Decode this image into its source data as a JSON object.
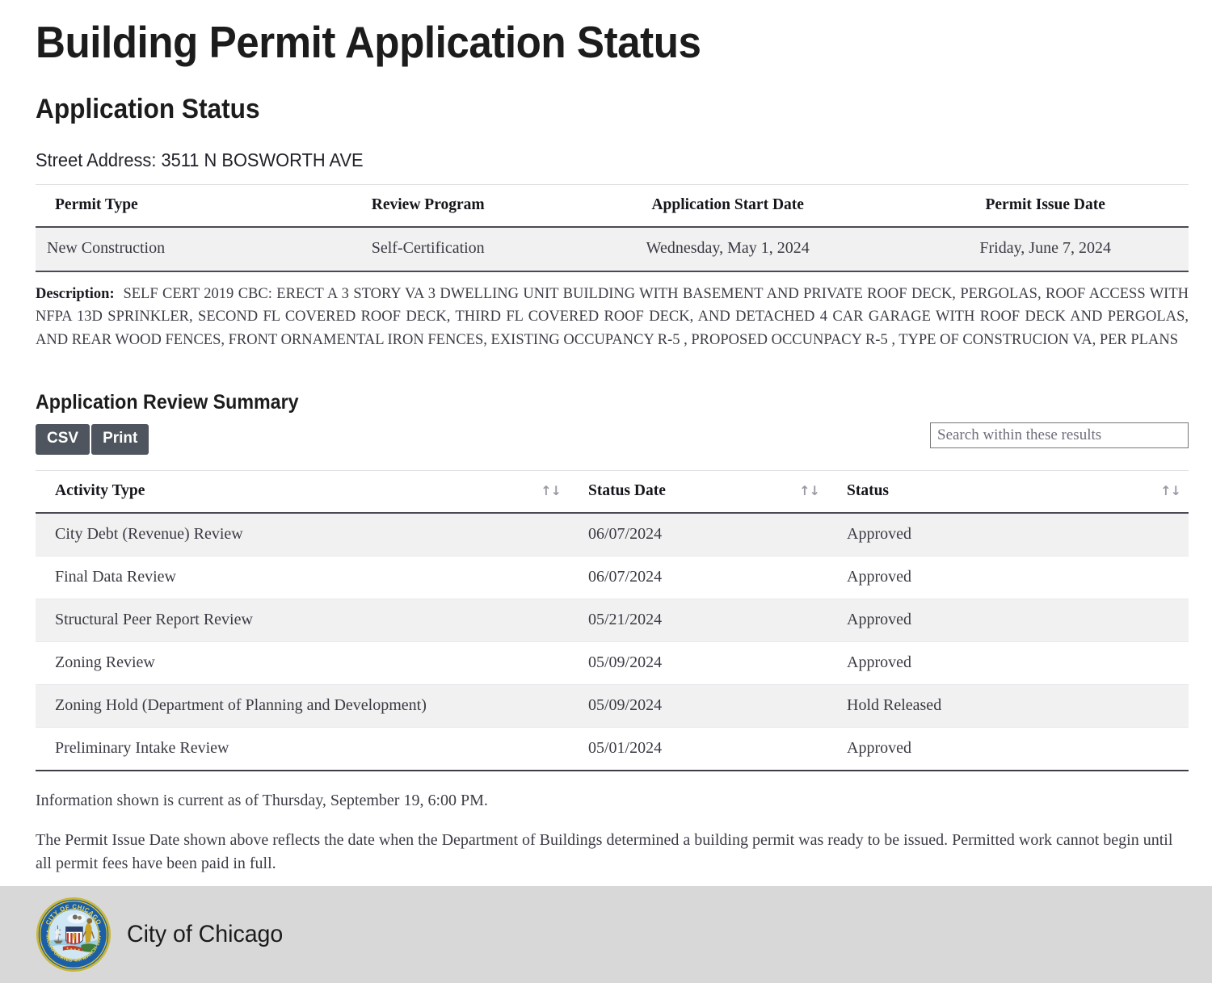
{
  "page": {
    "title": "Building Permit Application Status",
    "section_heading": "Application Status",
    "street_address": "Street Address: 3511 N BOSWORTH AVE"
  },
  "permit_summary": {
    "columns": [
      "Permit Type",
      "Review Program",
      "Application Start Date",
      "Permit Issue Date"
    ],
    "row": {
      "permit_type": "New Construction",
      "review_program": "Self-Certification",
      "application_start_date": "Wednesday, May 1, 2024",
      "permit_issue_date": "Friday, June 7, 2024"
    }
  },
  "description": {
    "label": "Description:",
    "text": "SELF CERT 2019 CBC: ERECT A 3 STORY VA 3 DWELLING UNIT BUILDING WITH BASEMENT AND PRIVATE ROOF DECK, PERGOLAS, ROOF ACCESS WITH NFPA 13D SPRINKLER, SECOND FL COVERED ROOF DECK, THIRD FL COVERED ROOF DECK, AND DETACHED 4 CAR GARAGE WITH ROOF DECK AND PERGOLAS, AND REAR WOOD FENCES, FRONT ORNAMENTAL IRON FENCES, EXISTING OCCUPANCY R-5 , PROPOSED OCCUNPACY R-5 , TYPE OF CONSTRUCION VA, PER PLANS"
  },
  "review_summary": {
    "heading": "Application Review Summary",
    "buttons": {
      "csv": "CSV",
      "print": "Print"
    },
    "search": {
      "value": "",
      "placeholder": "Search within these results"
    },
    "sort_icon": "↑↓",
    "columns": [
      "Activity Type",
      "Status Date",
      "Status"
    ],
    "rows": [
      {
        "activity_type": "City Debt (Revenue) Review",
        "status_date": "06/07/2024",
        "status": "Approved"
      },
      {
        "activity_type": "Final Data Review",
        "status_date": "06/07/2024",
        "status": "Approved"
      },
      {
        "activity_type": "Structural Peer Report Review",
        "status_date": "05/21/2024",
        "status": "Approved"
      },
      {
        "activity_type": "Zoning Review",
        "status_date": "05/09/2024",
        "status": "Approved"
      },
      {
        "activity_type": "Zoning Hold (Department of Planning and Development)",
        "status_date": "05/09/2024",
        "status": "Hold Released"
      },
      {
        "activity_type": "Preliminary Intake Review",
        "status_date": "05/01/2024",
        "status": "Approved"
      }
    ]
  },
  "notes": {
    "currency": "Information shown is current as of Thursday, September 19, 6:00 PM.",
    "disclaimer": "The Permit Issue Date shown above reflects the date when the Department of Buildings determined a building permit was ready to be issued. Permitted work cannot begin until all permit fees have been paid in full."
  },
  "footer": {
    "organization": "City of Chicago",
    "seal_top_text": "CITY OF CHICAGO",
    "seal_bottom_text": "INCORPORATED 4th MARCH 1837"
  },
  "colors": {
    "button_bg": "#4f555e",
    "table_stripe": "#f1f1f1",
    "footer_bg": "#d8d8d8",
    "seal_gold": "#d8c23e",
    "seal_blue": "#1a5fa8",
    "text": "#3c3c46"
  }
}
